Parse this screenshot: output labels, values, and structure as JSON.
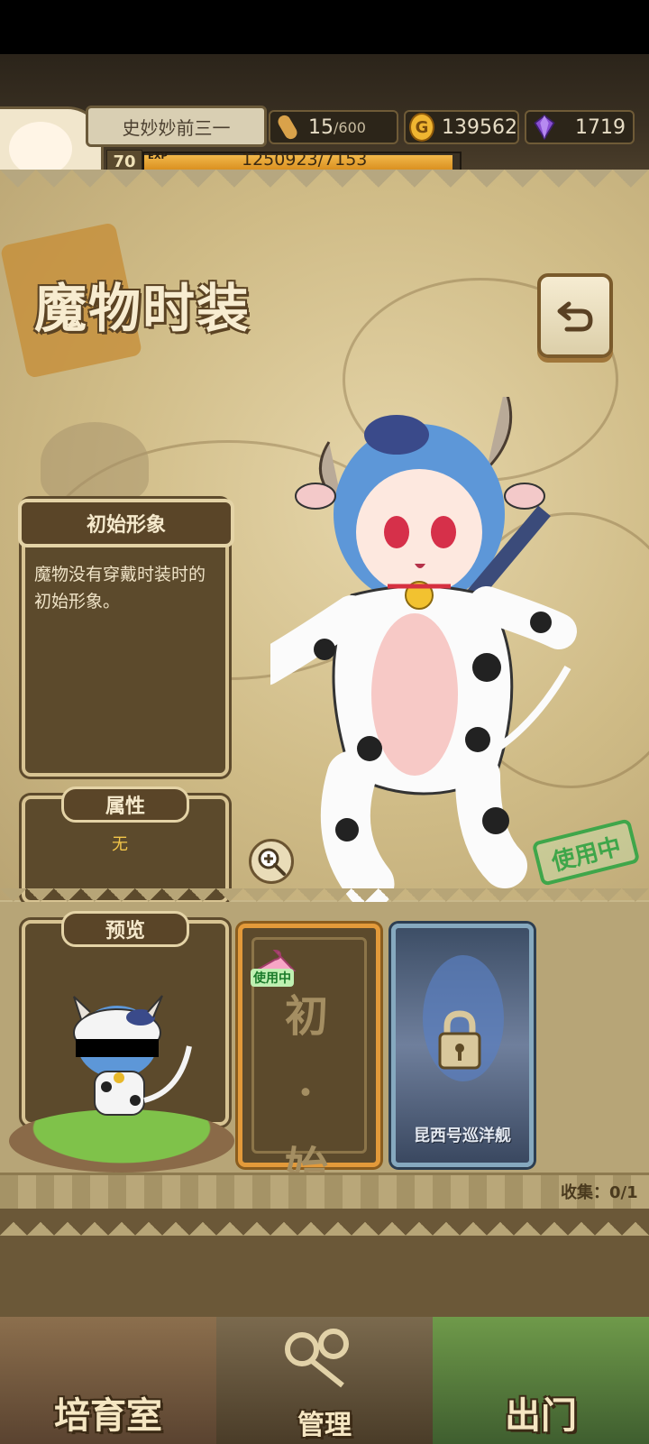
{
  "hud": {
    "player_name": "史妙妙前三一",
    "stamina": "15",
    "stamina_max": "/600",
    "gold": "139562",
    "gems": "1719",
    "level": "70",
    "exp_label": "EXP",
    "exp_text": "1250923/7153",
    "exp_fraction": 0.99
  },
  "screen": {
    "title": "魔物时装"
  },
  "costume": {
    "name": "初始形象",
    "description": "魔物没有穿戴时装时的初始形象。",
    "attributes_label": "属性",
    "attributes_value": "无",
    "in_use_stamp": "使用中",
    "preview_label": "预览"
  },
  "cards": [
    {
      "title": "初·始",
      "tag": "使用中",
      "selected": true
    },
    {
      "name": "昆西号巡洋舰",
      "locked": true
    }
  ],
  "collection": {
    "text": "收集：0/1"
  },
  "nav": {
    "breeding": "培育室",
    "manage": "管理",
    "exit": "出门"
  },
  "colors": {
    "parchment": "#c8b88b",
    "panel_dark": "#5c4a2c",
    "selected_border": "#e39a3a",
    "in_use_green": "#3fa64a",
    "attr_value": "#f3c64a"
  },
  "icons": [
    "bread-icon",
    "gold-coin-icon",
    "gem-icon",
    "back-arrow-icon",
    "zoom-in-icon",
    "lock-icon",
    "hanger-icon"
  ]
}
